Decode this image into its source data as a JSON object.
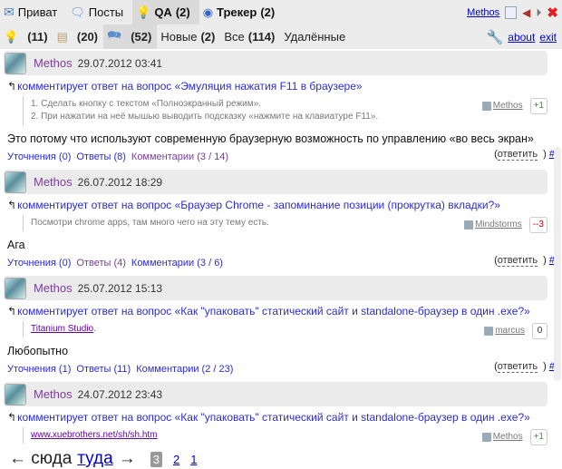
{
  "tabs": [
    {
      "label": "Приват",
      "count": "",
      "icon": "envelope-icon"
    },
    {
      "label": "Посты",
      "count": "",
      "icon": "speech-bubble-icon"
    },
    {
      "label": "QA",
      "count": "(2)",
      "icon": "lightbulb-icon",
      "active": true
    },
    {
      "label": "Трекер",
      "count": "(2)",
      "icon": "eye-icon"
    }
  ],
  "top_right": {
    "user": "Methos"
  },
  "subbar": {
    "lightbulb_count": "(11)",
    "comment_count": "(20)",
    "bubbles_count": "(52)",
    "new_label": "Новые",
    "new_count": "(2)",
    "all_label": "Все",
    "all_count": "(114)",
    "deleted_label": "Удалённые",
    "about": "about",
    "exit": "exit"
  },
  "entries": [
    {
      "user": "Methos",
      "date": "29.07.2012 03:41",
      "context": "комментирует ответ на вопрос «Эмуляция нажатия F11 в браузере»",
      "quote": [
        "1. Сделать кнопку с текстом «Полноэкранный режим».",
        "2. При нажатии на неё мышью выводить подсказку «нажмите на клавиатуре F11»."
      ],
      "quote_author": "Methos",
      "vote": "+1",
      "body": "Это потому что используют современную браузерную возможность по управлению «во весь экран»",
      "links": [
        "Уточнения (0)",
        "Ответы (8)",
        "Комментарии (3 / 14)"
      ]
    },
    {
      "user": "Methos",
      "date": "26.07.2012 18:29",
      "context": "комментирует ответ на вопрос «Браузер Chrome - запоминание позиции (прокрутка) вкладки?»",
      "quote": [
        "Посмотри chrome apps, там много чего на эту тему есть."
      ],
      "quote_author": "Mindstorms",
      "vote": "--3",
      "body": "Ага",
      "links": [
        "Уточнения (0)",
        "Ответы (4)",
        "Комментарии (3 / 6)"
      ]
    },
    {
      "user": "Methos",
      "date": "25.07.2012 15:13",
      "context": "комментирует ответ на вопрос «Как \"упаковать\" статический сайт и standalone-браузер в один .exe?»",
      "quote_link": "Titanium Studio",
      "quote_tail": ".",
      "quote_author": "marcus",
      "vote": "0",
      "body": "Любопытно",
      "links": [
        "Уточнения (1)",
        "Ответы (11)",
        "Комментарии (2 / 23)"
      ]
    },
    {
      "user": "Methos",
      "date": "24.07.2012 23:43",
      "context": "комментирует ответ на вопрос «Как \"упаковать\" статический сайт и standalone-браузер в один .exe?»",
      "quote_link": "www.xuebrothers.net/sh/sh.htm",
      "quote_author": "Methos",
      "vote": "+1"
    }
  ],
  "reply": {
    "label": "ответить",
    "hash": "#"
  },
  "pager": {
    "prev": "← сюда",
    "next": "туда",
    "arrow": "→",
    "pages": [
      "3",
      "2",
      "1"
    ]
  }
}
